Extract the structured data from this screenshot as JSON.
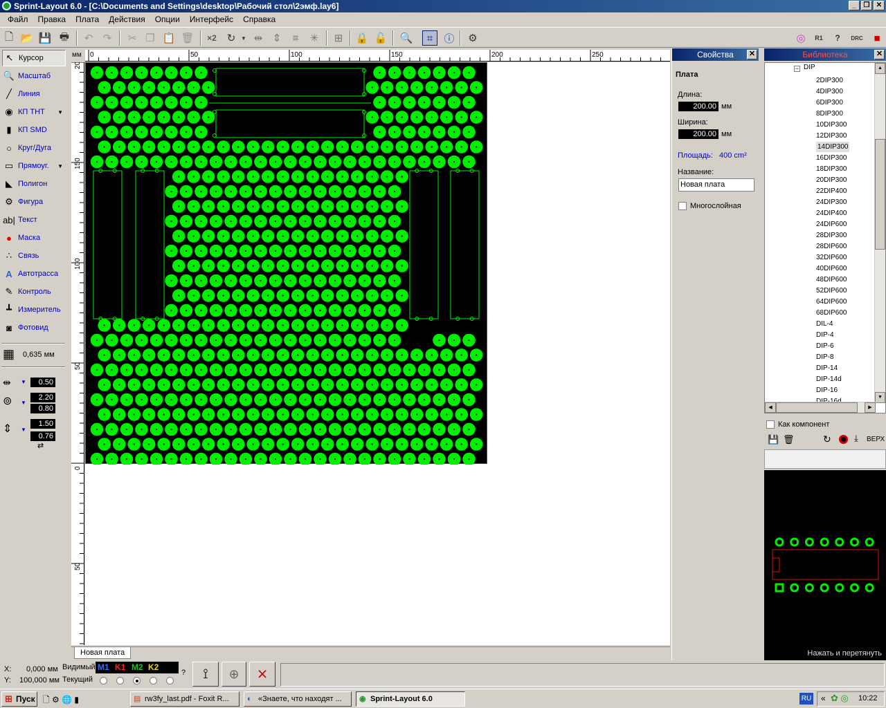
{
  "window": {
    "title": "Sprint-Layout 6.0 - [C:\\Documents and Settings\\desktop\\Рабочий стол\\2эмф.lay6]",
    "minimize": "_",
    "maximize": "❐",
    "close": "✕"
  },
  "menu": [
    "Файл",
    "Правка",
    "Плата",
    "Действия",
    "Опции",
    "Интерфейс",
    "Справка"
  ],
  "tools": [
    {
      "label": "Курсор",
      "icon": "cursor-icon",
      "glyph": "↖"
    },
    {
      "label": "Масштаб",
      "icon": "zoom-icon",
      "glyph": "🔍"
    },
    {
      "label": "Линия",
      "icon": "line-icon",
      "glyph": "╱"
    },
    {
      "label": "КП THT",
      "icon": "tht-pad-icon",
      "glyph": "◉"
    },
    {
      "label": "КП SMD",
      "icon": "smd-pad-icon",
      "glyph": "▮"
    },
    {
      "label": "Круг/Дуга",
      "icon": "circle-icon",
      "glyph": "○"
    },
    {
      "label": "Прямоуг.",
      "icon": "rectangle-icon",
      "glyph": "▭"
    },
    {
      "label": "Полигон",
      "icon": "polygon-icon",
      "glyph": "◣"
    },
    {
      "label": "Фигура",
      "icon": "shape-icon",
      "glyph": "⚙"
    },
    {
      "label": "Текст",
      "icon": "text-icon",
      "glyph": "ab|"
    },
    {
      "label": "Маска",
      "icon": "mask-icon",
      "glyph": "●"
    },
    {
      "label": "Связь",
      "icon": "connection-icon",
      "glyph": "∴"
    },
    {
      "label": "Автотрасса",
      "icon": "autoroute-icon",
      "glyph": "A"
    },
    {
      "label": "Контроль",
      "icon": "control-icon",
      "glyph": "✎"
    },
    {
      "label": "Измеритель",
      "icon": "measure-icon",
      "glyph": "┻"
    },
    {
      "label": "Фотовид",
      "icon": "photoview-icon",
      "glyph": "◙"
    }
  ],
  "grid": {
    "value": "0,635 мм"
  },
  "params": {
    "track_width": "0.50",
    "pad_outer": "2.20",
    "pad_inner": "0.80",
    "smd_w": "1.50",
    "smd_h": "0.76"
  },
  "ruler": {
    "unit": "мм",
    "top": [
      "0",
      "50",
      "100",
      "150",
      "200",
      "250"
    ],
    "left": [
      "200",
      "150",
      "100",
      "50",
      "0",
      "50"
    ]
  },
  "board_tab": "Новая плата",
  "properties": {
    "title": "Свойства",
    "section": "Плата",
    "length_label": "Длина:",
    "length": "200.00",
    "width_label": "Ширина:",
    "width": "200.00",
    "unit": "мм",
    "area_label": "Площадь:",
    "area": "400 cm²",
    "name_label": "Название:",
    "name": "Новая плата",
    "multilayer_label": "Многослойная"
  },
  "library": {
    "title": "Библиотека",
    "folder": "DIP",
    "items": [
      "2DIP300",
      "4DIP300",
      "6DIP300",
      "8DIP300",
      "10DIP300",
      "12DIP300",
      "14DIP300",
      "16DIP300",
      "18DIP300",
      "20DIP300",
      "22DIP400",
      "24DIP300",
      "24DIP400",
      "24DIP600",
      "28DIP300",
      "28DIP600",
      "32DIP600",
      "40DIP600",
      "48DIP600",
      "52DIP600",
      "64DIP600",
      "68DIP600",
      "DIL-4",
      "DIP-4",
      "DIP-6",
      "DIP-8",
      "DIP-14",
      "DIP-14d",
      "DIP-16",
      "DIP-16d"
    ],
    "selected": "14DIP300",
    "as_component": "Как компонент",
    "layer": "ВЕРХ",
    "hint": "Нажать и перетянуть"
  },
  "status": {
    "x_label": "X:",
    "x": "0,000 мм",
    "y_label": "Y:",
    "y": "100,000 мм",
    "visible": "Видимый",
    "current": "Текущий",
    "layers": [
      {
        "name": "M1",
        "color": "#3a6cff"
      },
      {
        "name": "K1",
        "color": "#ff2020"
      },
      {
        "name": "M2",
        "color": "#20c020"
      },
      {
        "name": "K2",
        "color": "#e8d020"
      }
    ],
    "q": "?"
  },
  "taskbar": {
    "start": "Пуск",
    "tasks": [
      "rw3fy_last.pdf - Foxit R...",
      "«Знаете, что находят ...",
      "Sprint-Layout 6.0"
    ],
    "lang": "RU",
    "clock": "10:22",
    "chev": "«"
  },
  "colors": {
    "copper": "#00ee00",
    "board": "#000000",
    "title": "#0a246a"
  }
}
